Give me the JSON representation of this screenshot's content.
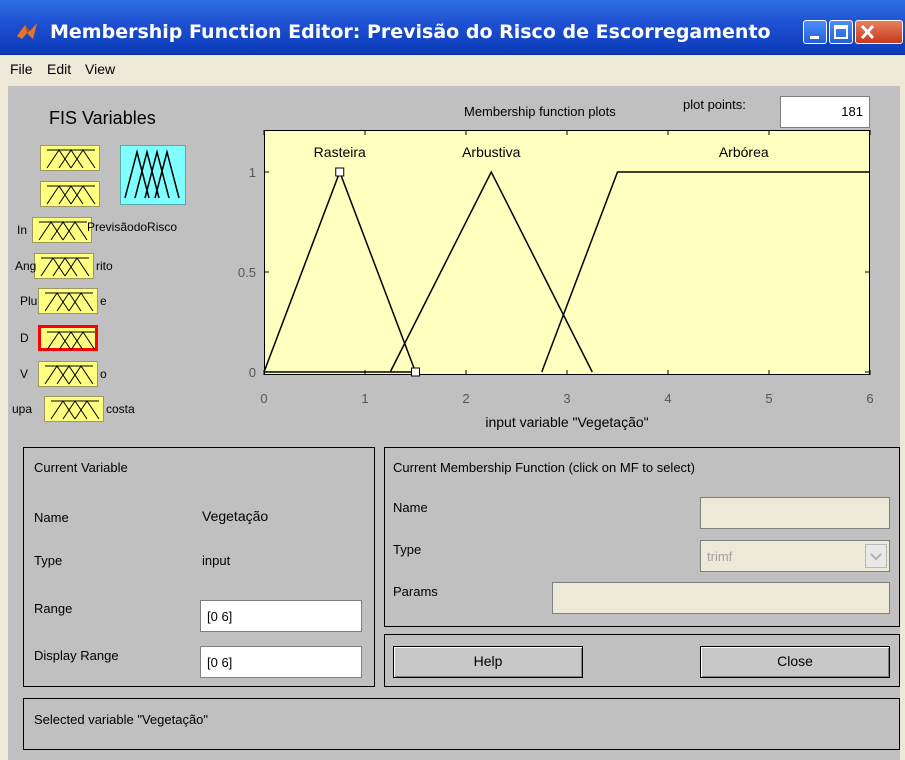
{
  "window": {
    "title": "Membership Function Editor: Previsão do Risco de Escorregamento"
  },
  "menu": [
    "File",
    "Edit",
    "View"
  ],
  "fis_variables": {
    "title": "FIS Variables",
    "output_name": "PrevisãodoRisco",
    "inputs": [
      {
        "label_left": "In",
        "label_right": "",
        "selected": false
      },
      {
        "label_left": "Ang",
        "label_right": "rito",
        "selected": false
      },
      {
        "label_left": "Plu",
        "label_right": "e",
        "selected": false
      },
      {
        "label_left": "D",
        "label_right": "",
        "selected": true
      },
      {
        "label_left": "V",
        "label_right": "o",
        "selected": false
      },
      {
        "label_left": "upa",
        "label_right": "costa",
        "selected": false
      }
    ]
  },
  "plot": {
    "header": "Membership function plots",
    "plot_points_label": "plot points:",
    "plot_points_value": "181",
    "xlabel": "input variable \"Vegetação\""
  },
  "chart_data": {
    "type": "line",
    "xlim": [
      0,
      6
    ],
    "ylim": [
      -0.05,
      1.1
    ],
    "x_ticks": [
      "0",
      "1",
      "2",
      "3",
      "4",
      "5",
      "6"
    ],
    "y_ticks": [
      "0",
      "0.5",
      "1"
    ],
    "series": [
      {
        "name": "Rasteira",
        "type": "trimf",
        "params": [
          0,
          0.75,
          1.5
        ],
        "color": "#000000",
        "x": [
          0,
          0.75,
          1.5
        ],
        "y": [
          0,
          1,
          0
        ]
      },
      {
        "name": "Arbustiva",
        "type": "trimf",
        "params": [
          1.25,
          2.25,
          3.25
        ],
        "color": "#000000",
        "x": [
          1.25,
          2.25,
          3.25
        ],
        "y": [
          0,
          1,
          0
        ]
      },
      {
        "name": "Arbórea",
        "type": "trapmf",
        "params": [
          2.75,
          3.5,
          6,
          6
        ],
        "color": "#000000",
        "x": [
          2.75,
          3.5,
          6
        ],
        "y": [
          0,
          1,
          1
        ]
      }
    ]
  },
  "current_variable": {
    "title": "Current Variable",
    "name_label": "Name",
    "name_value": "Vegetação",
    "type_label": "Type",
    "type_value": "input",
    "range_label": "Range",
    "range_value": "[0 6]",
    "display_range_label": "Display Range",
    "display_range_value": "[0 6]"
  },
  "current_mf": {
    "title": "Current Membership Function (click on MF to select)",
    "name_label": "Name",
    "name_value": "",
    "type_label": "Type",
    "type_value": "trimf",
    "params_label": "Params",
    "params_value": ""
  },
  "buttons": {
    "help": "Help",
    "close": "Close"
  },
  "status": "Selected variable \"Vegetação\""
}
